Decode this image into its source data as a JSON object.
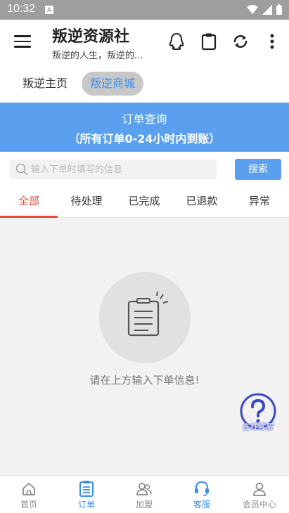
{
  "status_bar": {
    "time": "10:32"
  },
  "app_bar": {
    "title": "叛逆资源社",
    "subtitle": "叛逆的人生，叛逆的..."
  },
  "chips": [
    "叛逆主页",
    "叛逆商城"
  ],
  "banner": {
    "line1": "订单查询",
    "line2": "（所有订单0-24小时内到账）"
  },
  "search": {
    "placeholder": "输入下单时填写的信息",
    "value": "",
    "button": "搜索"
  },
  "tabs": [
    "全部",
    "待处理",
    "已完成",
    "已退款",
    "异常"
  ],
  "empty_message": "请在上方输入下单信息!",
  "help_label": "在线客服",
  "bottom_nav": [
    "首页",
    "订单",
    "加盟",
    "客服",
    "会员中心"
  ],
  "colors": {
    "accent": "#3a8ee6",
    "banner": "#5aa0ee",
    "active_tab": "#e74c3c"
  }
}
